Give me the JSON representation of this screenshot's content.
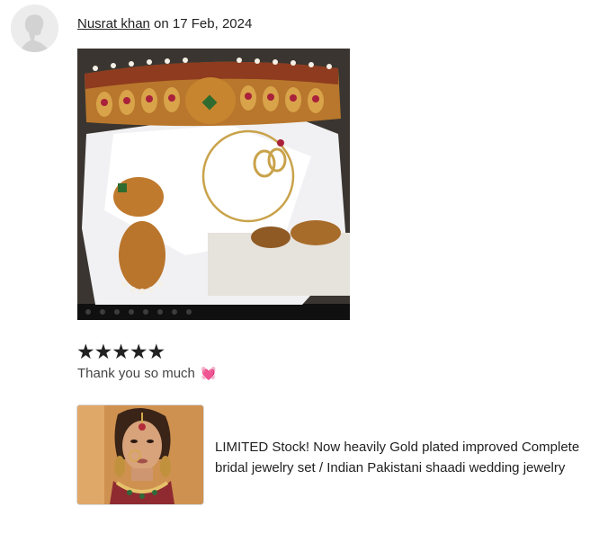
{
  "review": {
    "author": "Nusrat khan",
    "date_prefix": "on",
    "date": "17 Feb, 2024",
    "rating": 5,
    "stars": "★★★★★",
    "text": "Thank you so much",
    "emoji": "💓"
  },
  "product": {
    "title": "LIMITED Stock! Now heavily Gold plated improved Complete bridal jewelry set / Indian Pakistani shaadi wedding jewelry"
  },
  "colors": {
    "text": "#222222",
    "muted_text": "#444444",
    "avatar_bg": "#ececec"
  },
  "icons": {
    "avatar": "default-user-avatar",
    "rating": "star-icon"
  }
}
